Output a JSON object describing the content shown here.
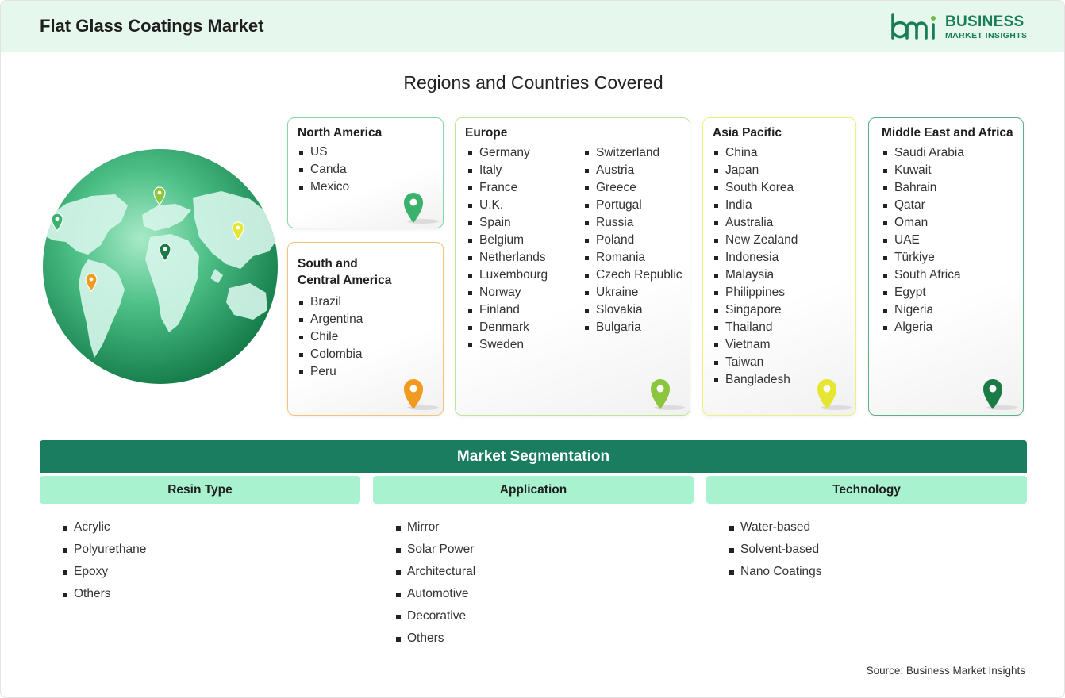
{
  "header": {
    "title": "Flat Glass Coatings Market"
  },
  "logo": {
    "line1": "BUSINESS",
    "line2": "MARKET INSIGHTS",
    "mark": "bmi"
  },
  "regions_title": "Regions and Countries Covered",
  "regions": {
    "north_america": {
      "title": "North America",
      "countries": [
        "US",
        "Canda",
        "Mexico"
      ],
      "color": "#39b36b"
    },
    "south_central_america": {
      "title_line1": "South and",
      "title_line2": "Central America",
      "countries": [
        "Brazil",
        "Argentina",
        "Chile",
        "Colombia",
        "Peru"
      ],
      "color": "#f29a1f"
    },
    "europe": {
      "title": "Europe",
      "countries_col1": [
        "Germany",
        "Italy",
        "France",
        "U.K.",
        "Spain",
        "Belgium",
        "Netherlands",
        "Luxembourg",
        "Norway",
        "Finland",
        "Denmark",
        "Sweden"
      ],
      "countries_col2": [
        "Switzerland",
        "Austria",
        "Greece",
        "Portugal",
        "Russia",
        "Poland",
        "Romania",
        "Czech Republic",
        "Ukraine",
        "Slovakia",
        "Bulgaria"
      ],
      "color": "#8cc63f"
    },
    "asia_pacific": {
      "title": "Asia Pacific",
      "countries": [
        "China",
        "Japan",
        "South Korea",
        "India",
        "Australia",
        "New Zealand",
        "Indonesia",
        "Malaysia",
        "Philippines",
        "Singapore",
        "Thailand",
        "Vietnam",
        "Taiwan",
        "Bangladesh"
      ],
      "color": "#e6e632"
    },
    "middle_east_africa": {
      "title": "Middle East and Africa",
      "countries": [
        "Saudi Arabia",
        "Kuwait",
        "Bahrain",
        "Qatar",
        "Oman",
        "UAE",
        "Türkiye",
        "South Africa",
        "Egypt",
        "Nigeria",
        "Algeria"
      ],
      "color": "#1b7a45"
    }
  },
  "segmentation": {
    "title": "Market Segmentation",
    "columns": [
      {
        "heading": "Resin Type",
        "items": [
          "Acrylic",
          "Polyurethane",
          "Epoxy",
          "Others"
        ]
      },
      {
        "heading": "Application",
        "items": [
          "Mirror",
          "Solar Power",
          "Architectural",
          "Automotive",
          "Decorative",
          "Others"
        ]
      },
      {
        "heading": "Technology",
        "items": [
          "Water-based",
          "Solvent-based",
          "Nano Coatings"
        ]
      }
    ]
  },
  "source": "Source: Business Market Insights",
  "icons": {
    "globe": "globe-icon",
    "pin": "map-pin-icon"
  }
}
